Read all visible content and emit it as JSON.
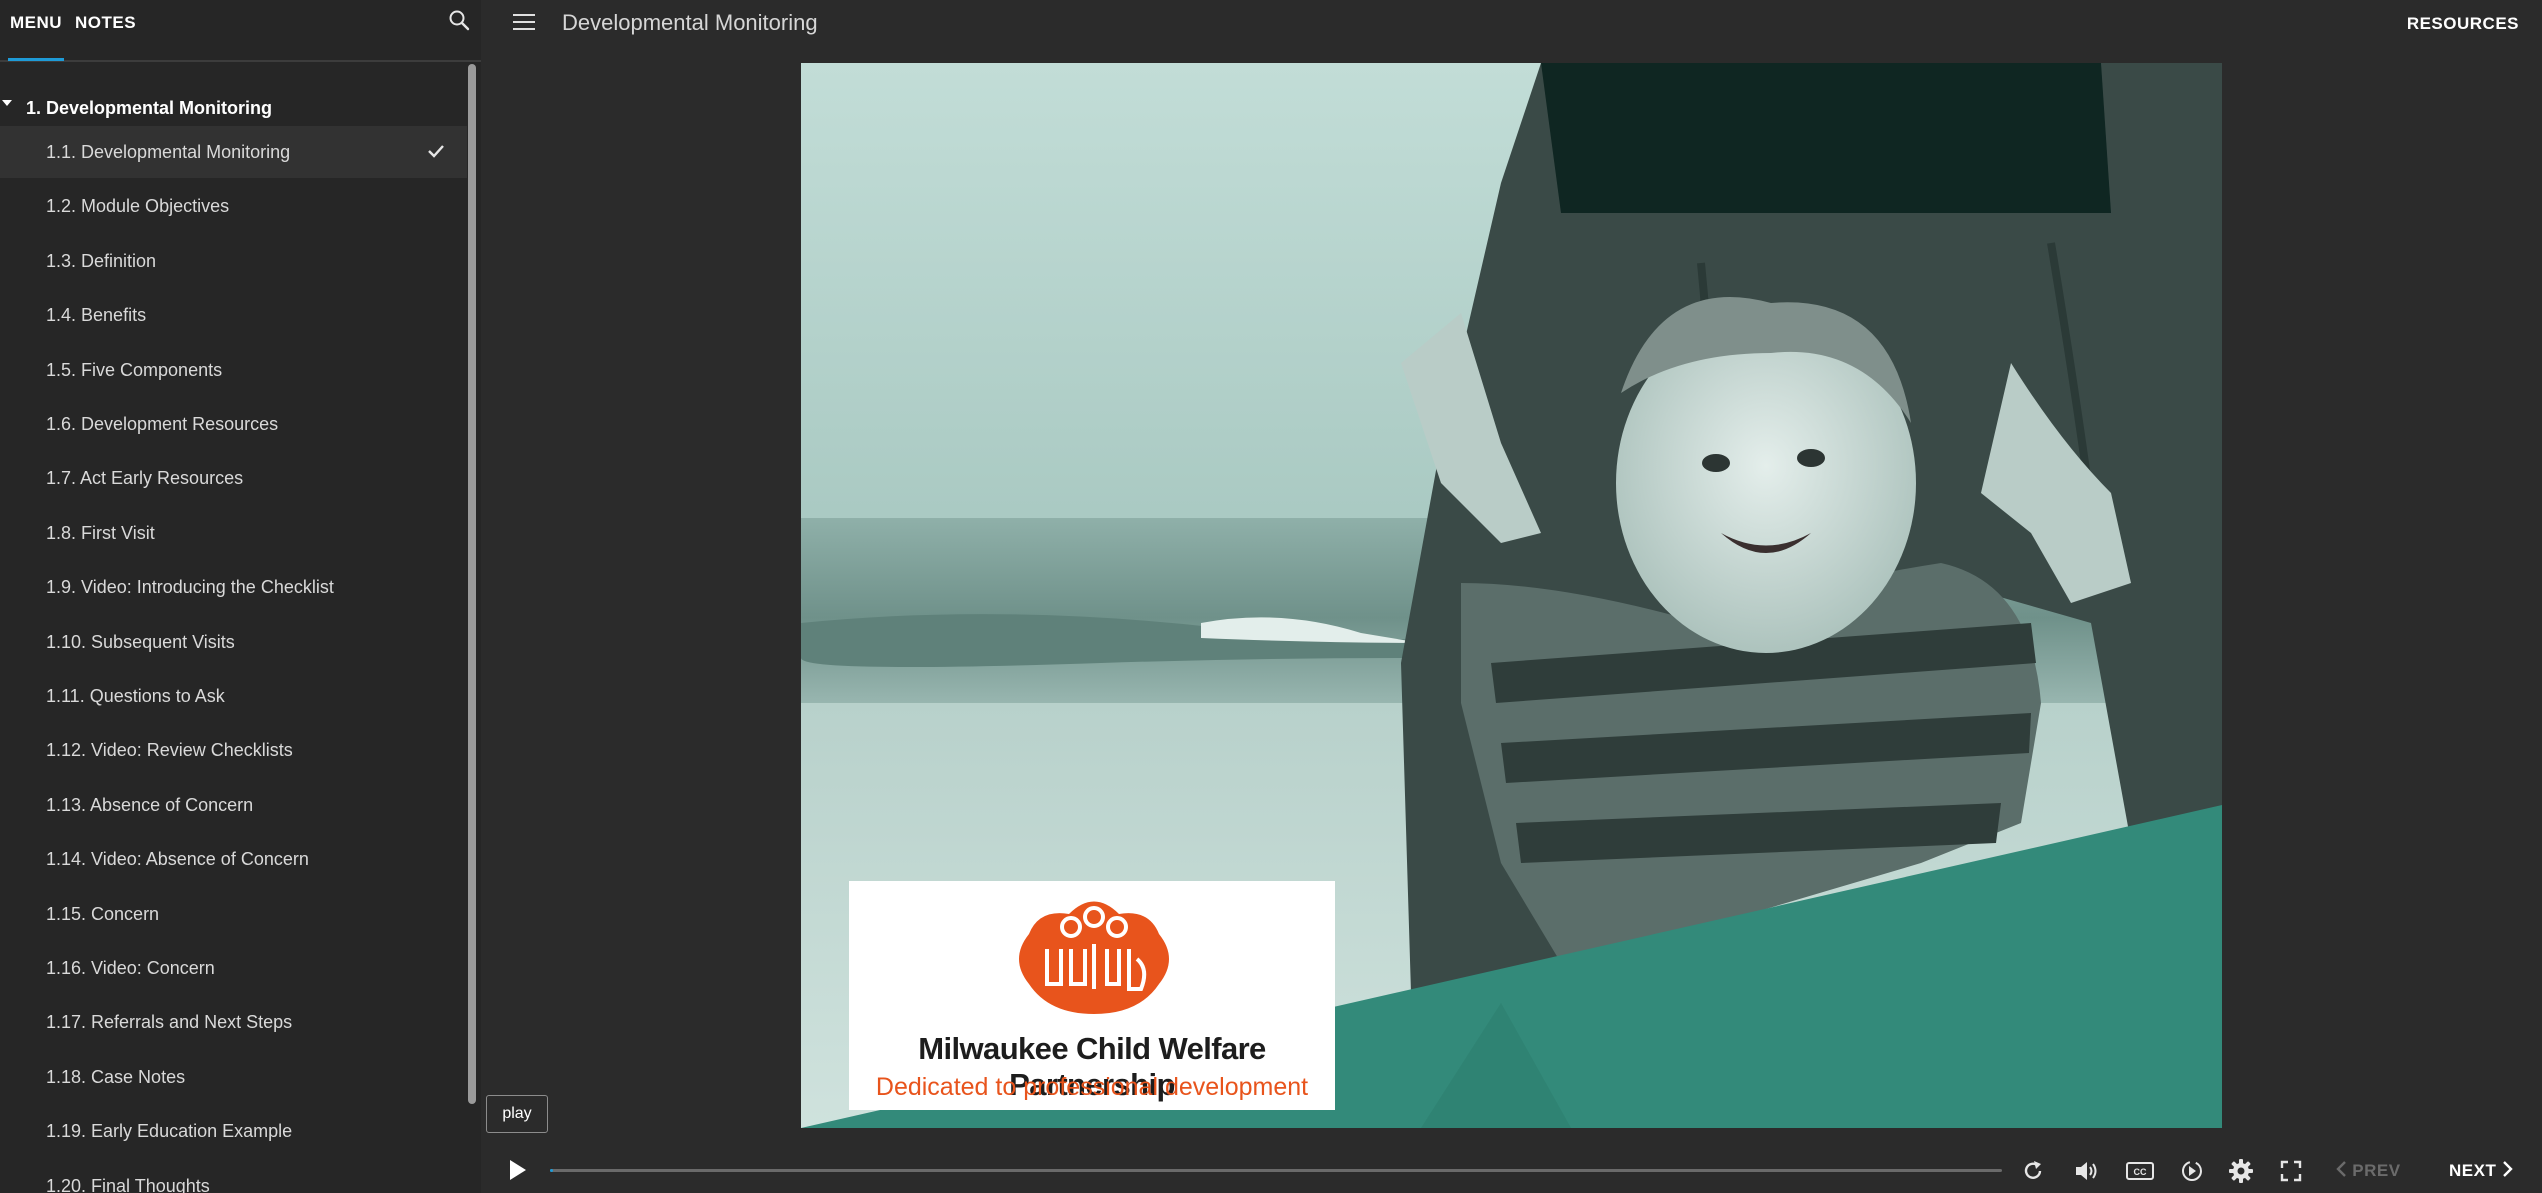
{
  "sidebar": {
    "tabs": {
      "menu": "MENU",
      "notes": "NOTES"
    },
    "section_title": "1. Developmental Monitoring",
    "items": [
      {
        "label": "1.1. Developmental Monitoring",
        "active": true,
        "completed": true
      },
      {
        "label": "1.2. Module Objectives"
      },
      {
        "label": "1.3. Definition"
      },
      {
        "label": "1.4. Benefits"
      },
      {
        "label": "1.5. Five Components"
      },
      {
        "label": "1.6. Development Resources"
      },
      {
        "label": "1.7. Act Early Resources"
      },
      {
        "label": "1.8. First Visit"
      },
      {
        "label": "1.9. Video: Introducing the Checklist"
      },
      {
        "label": "1.10. Subsequent Visits"
      },
      {
        "label": "1.11. Questions to Ask"
      },
      {
        "label": "1.12. Video: Review Checklists"
      },
      {
        "label": "1.13. Absence of Concern"
      },
      {
        "label": "1.14. Video: Absence of Concern"
      },
      {
        "label": "1.15. Concern"
      },
      {
        "label": "1.16. Video: Concern"
      },
      {
        "label": "1.17. Referrals and Next Steps"
      },
      {
        "label": "1.18. Case Notes"
      },
      {
        "label": "1.19. Early Education Example"
      },
      {
        "label": "1.20. Final Thoughts"
      }
    ]
  },
  "header": {
    "title": "Developmental Monitoring",
    "resources_label": "RESOURCES"
  },
  "slide": {
    "logo_name": "Milwaukee Child Welfare Partnership",
    "logo_tagline": "Dedicated to professional development",
    "logo_mark_text": "MCWP"
  },
  "tooltip": {
    "text": "play"
  },
  "playbar": {
    "progress_fraction": 0.002,
    "prev_label": "PREV",
    "next_label": "NEXT",
    "prev_enabled": false
  },
  "colors": {
    "accent": "#1e9bd7",
    "teal": "#338a7a",
    "logo_orange": "#e8541c"
  },
  "icons": [
    "search-icon",
    "hamburger-icon",
    "checkmark-icon",
    "play-icon",
    "replay-icon",
    "volume-icon",
    "closed-captions-icon",
    "playback-rate-icon",
    "settings-icon",
    "fullscreen-icon",
    "chevron-left-icon",
    "chevron-right-icon",
    "caret-down-icon"
  ]
}
